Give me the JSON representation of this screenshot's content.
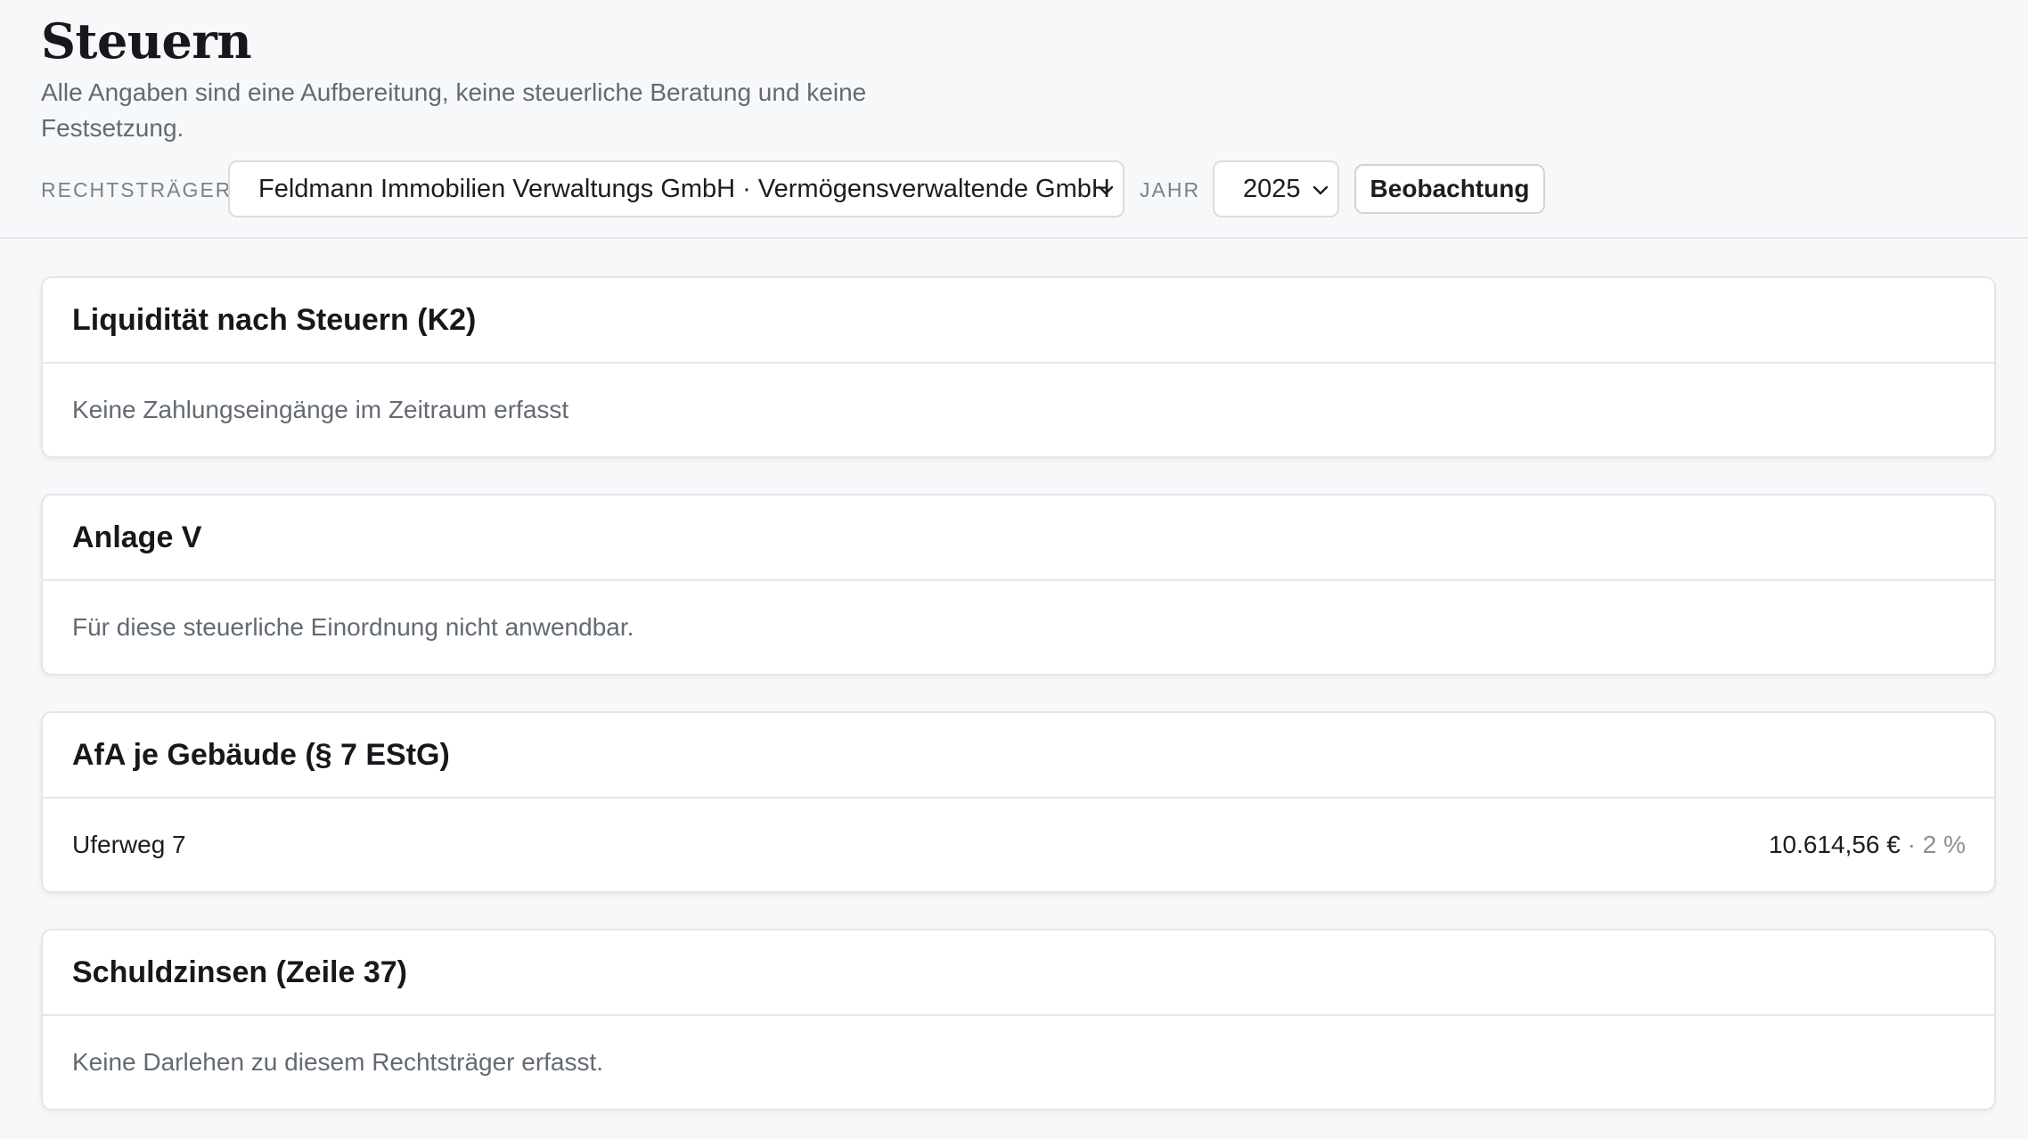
{
  "page": {
    "title": "Steuern",
    "subtitle": "Alle Angaben sind eine Aufbereitung, keine steuerliche Beratung und keine Festsetzung."
  },
  "filters": {
    "entity_label": "Rechtsträger",
    "entity_value": "Feldmann Immobilien Verwaltungs GmbH · Vermögensverwaltende GmbH",
    "year_label": "Jahr",
    "year_value": "2025",
    "observe_button": "Beobachtung"
  },
  "cards": {
    "liquidity": {
      "title": "Liquidität nach Steuern (K2)",
      "message": "Keine Zahlungseingänge im Zeitraum erfasst"
    },
    "anlage_v": {
      "title": "Anlage V",
      "message": "Für diese steuerliche Einordnung nicht anwendbar."
    },
    "afa": {
      "title": "AfA je Gebäude (§ 7 EStG)",
      "rows": [
        {
          "label": "Uferweg 7",
          "amount": "10.614,56 €",
          "separator": " · ",
          "rate": "2 %"
        }
      ]
    },
    "interest": {
      "title": "Schuldzinsen (Zeile 37)",
      "message": "Keine Darlehen zu diesem Rechtsträger erfasst."
    }
  },
  "colors": {
    "background": "#f7f8fa",
    "card": "#ffffff",
    "border": "#e2e5e9",
    "muted_text": "#636a73"
  }
}
